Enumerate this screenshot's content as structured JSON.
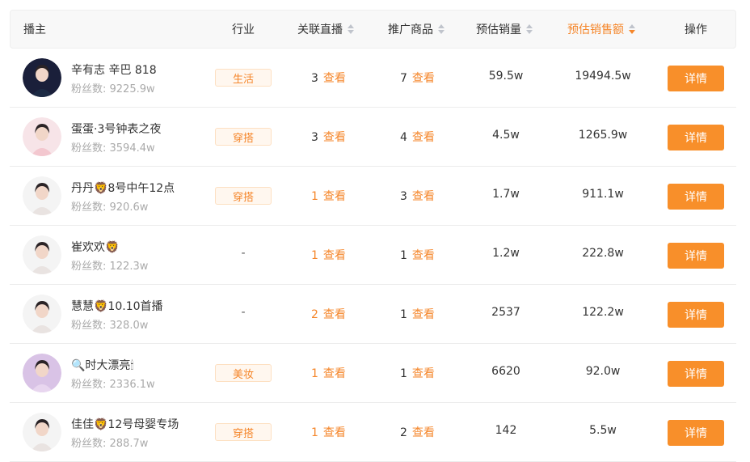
{
  "header": {
    "streamer": "播主",
    "industry": "行业",
    "related_live": "关联直播",
    "promoted_goods": "推广商品",
    "est_sales": "预估销量",
    "est_revenue": "预估销售额",
    "action": "操作"
  },
  "colors": {
    "accent": "#f5862a",
    "button": "#f88f2a"
  },
  "view_label": "查看",
  "detail_label": "详情",
  "rows": [
    {
      "name": "辛有志 辛巴 818",
      "fans": "粉丝数: 9225.9w",
      "industry": "生活",
      "live_count": "3",
      "goods_count": "7",
      "sales": "59.5w",
      "revenue": "19494.5w",
      "avatar": "dark-portrait"
    },
    {
      "name": "蛋蛋·3号钟表之夜",
      "fans": "粉丝数: 3594.4w",
      "industry": "穿搭",
      "live_count": "3",
      "goods_count": "4",
      "sales": "4.5w",
      "revenue": "1265.9w",
      "avatar": "pink-portrait"
    },
    {
      "name": "丹丹🦁8号中午12点",
      "fans": "粉丝数: 920.6w",
      "industry": "穿搭",
      "live_count": "1",
      "goods_count": "3",
      "sales": "1.7w",
      "revenue": "911.1w",
      "avatar": "portrait"
    },
    {
      "name": "崔欢欢🦁",
      "fans": "粉丝数: 122.3w",
      "industry": "-",
      "live_count": "1",
      "goods_count": "1",
      "sales": "1.2w",
      "revenue": "222.8w",
      "avatar": "portrait"
    },
    {
      "name": "慧慧🦁10.10首播",
      "fans": "粉丝数: 328.0w",
      "industry": "-",
      "live_count": "2",
      "goods_count": "1",
      "sales": "2537",
      "revenue": "122.2w",
      "avatar": "portrait"
    },
    {
      "name": "🔍时大漂亮🕯",
      "fans": "粉丝数: 2336.1w",
      "industry": "美妆",
      "live_count": "1",
      "goods_count": "1",
      "sales": "6620",
      "revenue": "92.0w",
      "avatar": "purple-portrait"
    },
    {
      "name": "佳佳🦁12号母婴专场",
      "fans": "粉丝数: 288.7w",
      "industry": "穿搭",
      "live_count": "1",
      "goods_count": "2",
      "sales": "142",
      "revenue": "5.5w",
      "avatar": "portrait"
    }
  ]
}
